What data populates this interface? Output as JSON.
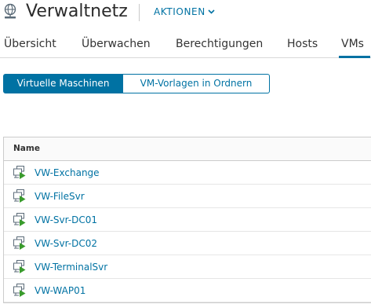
{
  "header": {
    "title": "Verwaltnetz",
    "actions_label": "AKTIONEN",
    "icon": "network-globe-icon"
  },
  "tabs": [
    {
      "label": "Übersicht",
      "active": false
    },
    {
      "label": "Überwachen",
      "active": false
    },
    {
      "label": "Berechtigungen",
      "active": false
    },
    {
      "label": "Hosts",
      "active": false
    },
    {
      "label": "VMs",
      "active": true
    }
  ],
  "subview": {
    "options": [
      "Virtuelle Maschinen",
      "VM-Vorlagen in Ordnern"
    ],
    "selected": "Virtuelle Maschinen"
  },
  "grid": {
    "columns": [
      "Name"
    ],
    "rows": [
      {
        "name": "VW-Exchange",
        "icon": "vm-powered-on-icon"
      },
      {
        "name": "VW-FileSvr",
        "icon": "vm-powered-on-icon"
      },
      {
        "name": "VW-Svr-DC01",
        "icon": "vm-powered-on-icon"
      },
      {
        "name": "VW-Svr-DC02",
        "icon": "vm-powered-on-icon"
      },
      {
        "name": "VW-TerminalSvr",
        "icon": "vm-powered-on-icon"
      },
      {
        "name": "VW-WAP01",
        "icon": "vm-powered-on-icon"
      }
    ]
  },
  "colors": {
    "accent": "#0072a3",
    "power_on": "#3a9c2d",
    "text": "#333333"
  }
}
